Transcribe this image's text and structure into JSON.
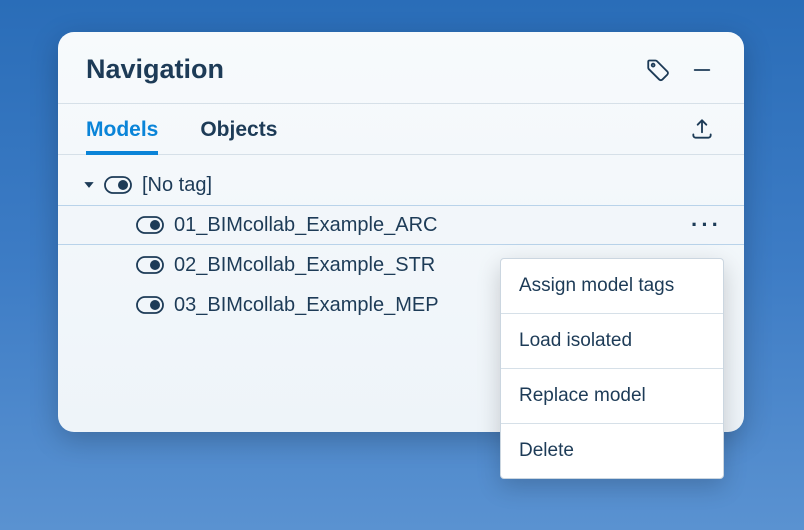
{
  "panel": {
    "title": "Navigation"
  },
  "tabs": {
    "models": "Models",
    "objects": "Objects",
    "active": "models"
  },
  "tree": {
    "group_label": "[No tag]",
    "items": [
      {
        "label": "01_BIMcollab_Example_ARC",
        "selected": true
      },
      {
        "label": "02_BIMcollab_Example_STR",
        "selected": false
      },
      {
        "label": "03_BIMcollab_Example_MEP",
        "selected": false
      }
    ]
  },
  "context_menu": {
    "items": [
      "Assign model tags",
      "Load isolated",
      "Replace model",
      "Delete"
    ]
  }
}
